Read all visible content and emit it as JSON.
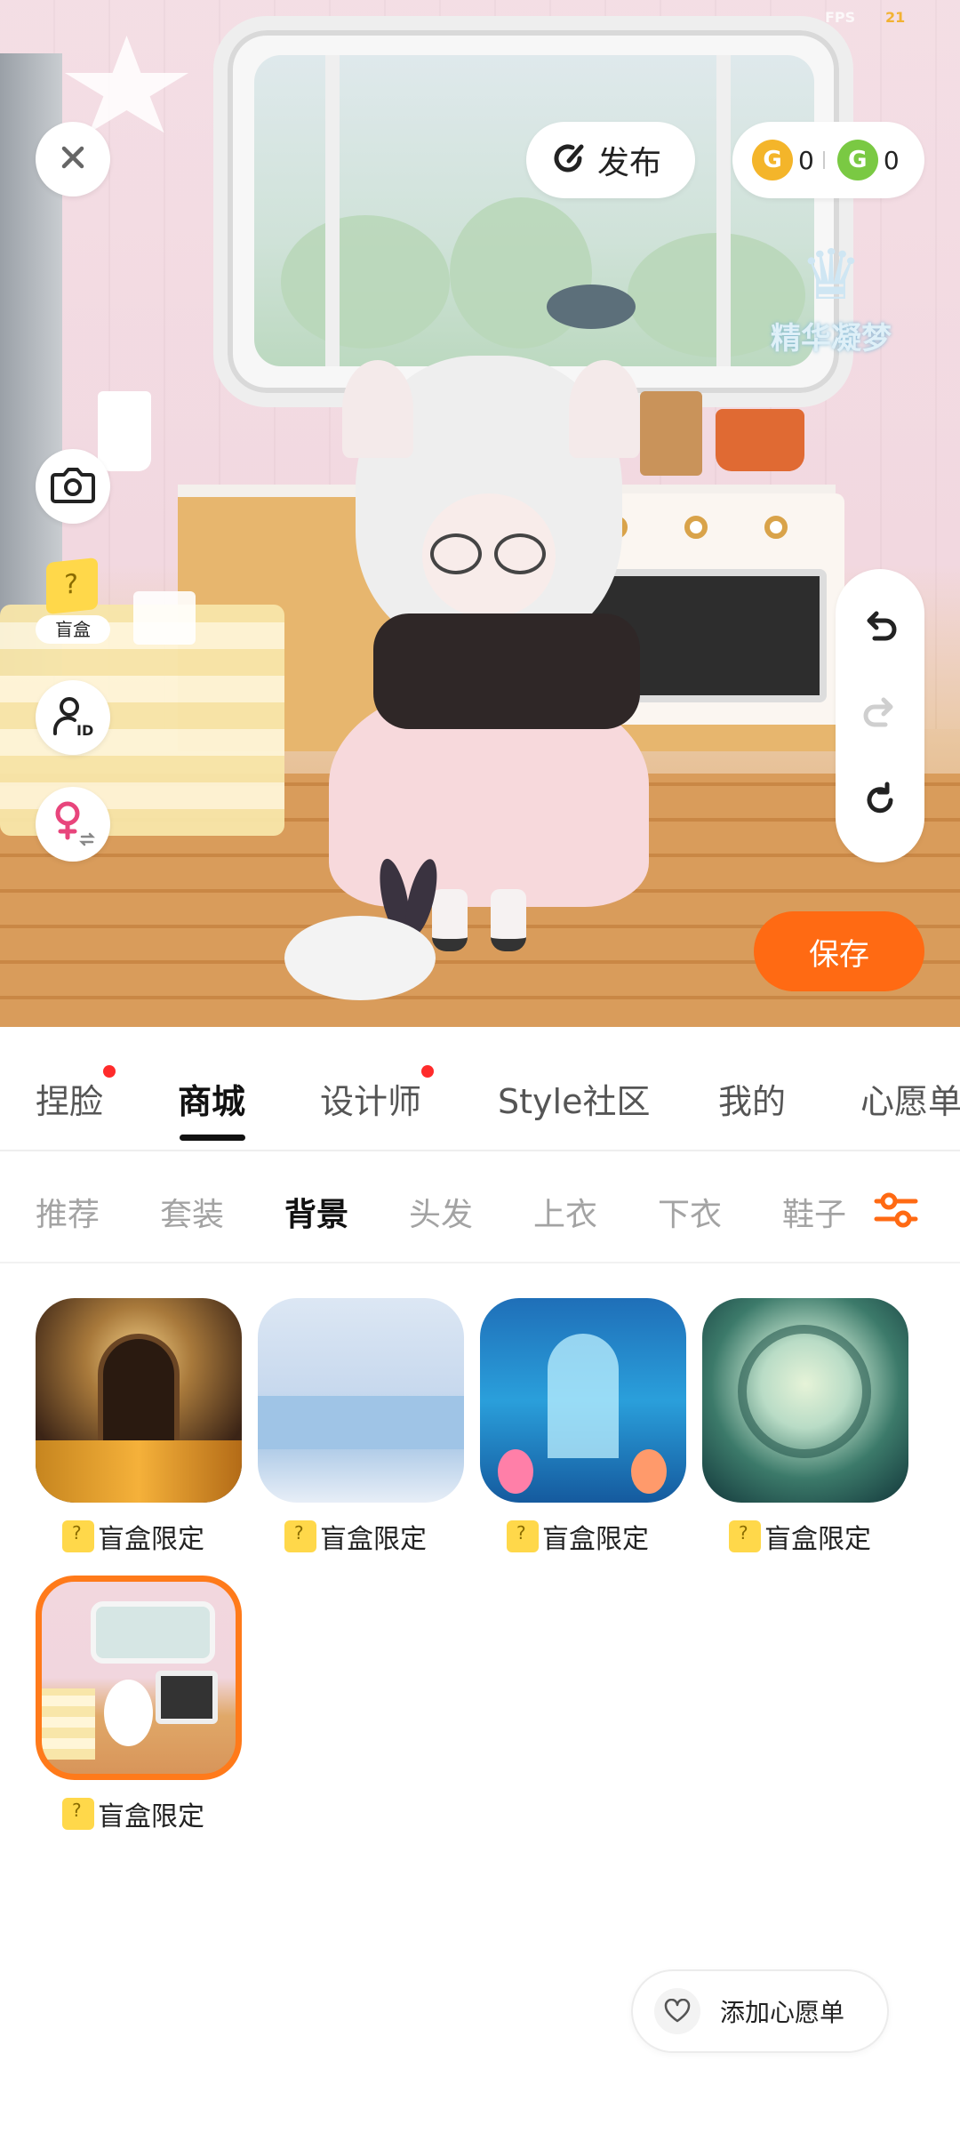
{
  "status": {
    "fps_label": "FPS",
    "fps_value": "21"
  },
  "scene": {
    "logo_text": "精华凝梦",
    "blind_box_label": "盲盒"
  },
  "top_bar": {
    "publish_label": "发布",
    "coin_gold_value": "0",
    "coin_green_value": "0",
    "coin_gold_icon": "G",
    "coin_green_icon": "G"
  },
  "save_label": "保存",
  "main_tabs": [
    {
      "label": "捏脸",
      "active": false,
      "dot": true
    },
    {
      "label": "商城",
      "active": true,
      "dot": false
    },
    {
      "label": "设计师",
      "active": false,
      "dot": true
    },
    {
      "label": "Style社区",
      "active": false,
      "dot": false
    },
    {
      "label": "我的",
      "active": false,
      "dot": false
    },
    {
      "label": "心愿单",
      "active": false,
      "dot": false
    }
  ],
  "sub_tabs": [
    {
      "label": "推荐",
      "active": false
    },
    {
      "label": "套装",
      "active": false
    },
    {
      "label": "背景",
      "active": true
    },
    {
      "label": "头发",
      "active": false
    },
    {
      "label": "上衣",
      "active": false
    },
    {
      "label": "下衣",
      "active": false
    },
    {
      "label": "鞋子",
      "active": false
    }
  ],
  "items": [
    {
      "label": "盲盒限定",
      "selected": false
    },
    {
      "label": "盲盒限定",
      "selected": false
    },
    {
      "label": "盲盒限定",
      "selected": false
    },
    {
      "label": "盲盒限定",
      "selected": false
    },
    {
      "label": "盲盒限定",
      "selected": true
    }
  ],
  "wishlist_label": "添加心愿单",
  "colors": {
    "accent": "#ff6a13",
    "selected_border": "#ff7a1a",
    "badge": "#ff2b2b"
  }
}
